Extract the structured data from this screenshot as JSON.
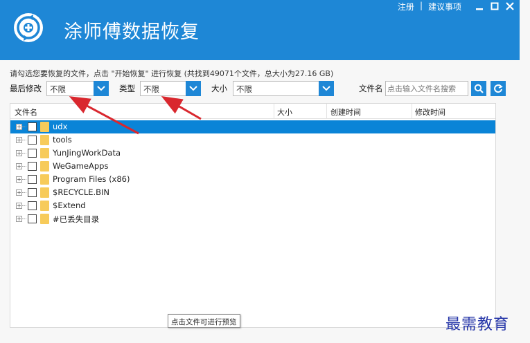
{
  "app": {
    "title": "涂师傅数据恢复"
  },
  "top_links": {
    "register": "注册",
    "separator": "|",
    "suggestion": "建议事项"
  },
  "info_text": "请勾选您要恢复的文件，点击 \"开始恢复\" 进行恢复 (共找到49071个文件，总大小为27.16 GB)",
  "filters": {
    "modified_label": "最后修改",
    "modified_value": "不限",
    "type_label": "类型",
    "type_value": "不限",
    "size_label": "大小",
    "size_value": "不限",
    "filename_label": "文件名",
    "filename_placeholder": "点击输入文件名搜索"
  },
  "table": {
    "columns": [
      "文件名",
      "大小",
      "创建时间",
      "修改时间"
    ],
    "rows": [
      {
        "name": "udx",
        "selected": true
      },
      {
        "name": "tools",
        "selected": false
      },
      {
        "name": "YunJingWorkData",
        "selected": false
      },
      {
        "name": "WeGameApps",
        "selected": false
      },
      {
        "name": "Program Files (x86)",
        "selected": false
      },
      {
        "name": "$RECYCLE.BIN",
        "selected": false
      },
      {
        "name": "$Extend",
        "selected": false
      },
      {
        "name": "#已丢失目录",
        "selected": false
      }
    ]
  },
  "tooltip": "点击文件可进行预览",
  "watermark": "最需教育",
  "icons": {
    "logo": "recovery-logo-icon",
    "minimize": "minimize-icon",
    "maximize": "maximize-icon",
    "close": "close-icon",
    "search": "search-icon",
    "refresh": "refresh-icon",
    "dropdown": "chevron-down-icon",
    "folder": "folder-icon"
  },
  "colors": {
    "accent": "#1e87d6",
    "selected_row": "#0a84d7",
    "annotation_arrow": "#d9272e",
    "folder": "#f7cb5a",
    "watermark": "#2636a8"
  }
}
